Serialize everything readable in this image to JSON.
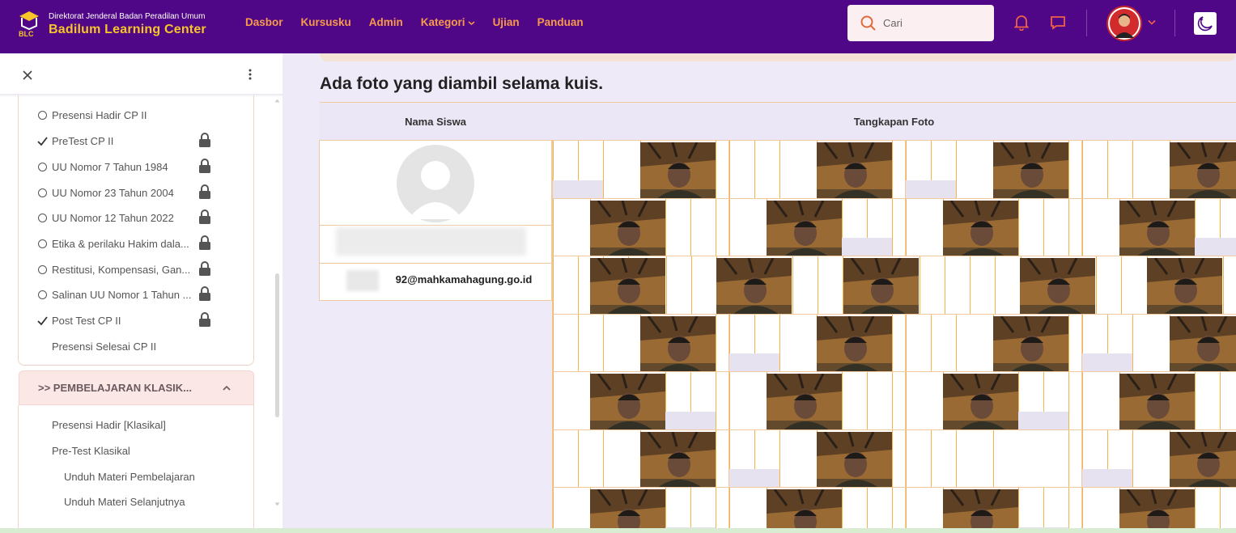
{
  "header": {
    "org_line": "Direktorat Jenderal Badan Peradilan Umum",
    "brand": "Badilum Learning Center",
    "nav": [
      "Dasbor",
      "Kursusku",
      "Admin",
      "Kategori",
      "Ujian",
      "Panduan"
    ],
    "search_placeholder": "Cari",
    "colors": {
      "bar": "#4f0787",
      "nav_text": "#f89a4a",
      "brand_text": "#f7c42a"
    }
  },
  "sidebar": {
    "items": [
      {
        "label": "Presensi Hadir CP II",
        "status": "circle",
        "locked": false
      },
      {
        "label": "PreTest CP II",
        "status": "check",
        "locked": true
      },
      {
        "label": "UU Nomor 7 Tahun 1984",
        "status": "circle",
        "locked": true
      },
      {
        "label": "UU Nomor 23 Tahun 2004",
        "status": "circle",
        "locked": true
      },
      {
        "label": "UU Nomor 12 Tahun 2022",
        "status": "circle",
        "locked": true
      },
      {
        "label": "Etika & perilaku Hakim dala...",
        "status": "circle",
        "locked": true
      },
      {
        "label": "Restitusi, Kompensasi, Gan...",
        "status": "circle",
        "locked": true
      },
      {
        "label": "Salinan UU Nomor 1 Tahun ...",
        "status": "circle",
        "locked": true
      },
      {
        "label": "Post Test CP II",
        "status": "check",
        "locked": true
      },
      {
        "label": "Presensi Selesai CP II",
        "status": "none",
        "locked": false
      }
    ],
    "section_title": ">> PEMBELAJARAN KLASIK...",
    "section_items": [
      "Presensi Hadir [Klasikal]",
      "Pre-Test Klasikal",
      "Unduh Materi Pembelajaran",
      "Unduh Materi Selanjutnya"
    ]
  },
  "main": {
    "title": "Ada foto yang diambil selama kuis.",
    "columns": [
      "Nama Siswa",
      "Tangkapan Foto"
    ],
    "student_email": "92@mahkamahagung.go.id"
  }
}
